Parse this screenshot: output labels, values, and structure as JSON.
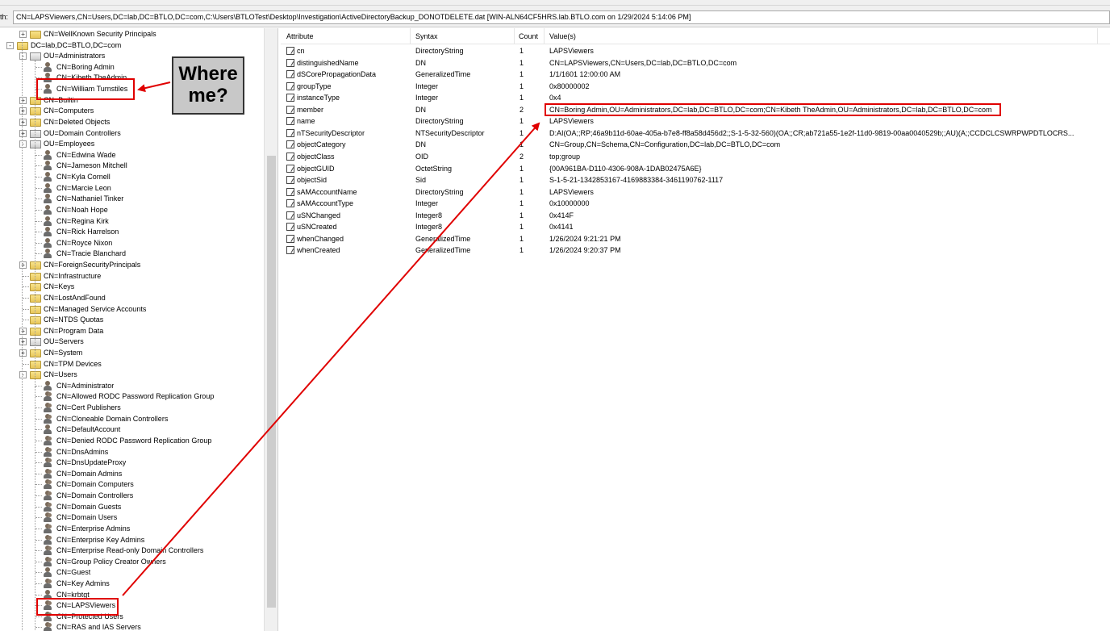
{
  "path": {
    "label": "th:",
    "value": "CN=LAPSViewers,CN=Users,DC=lab,DC=BTLO,DC=com,C:\\Users\\BTLOTest\\Desktop\\Investigation\\ActiveDirectoryBackup_DONOTDELETE.dat [WIN-ALN64CF5HRS.lab.BTLO.com on 1/29/2024 5:14:06 PM]"
  },
  "tree": [
    {
      "label": "CN=WellKnown Security Principals",
      "icon": "folder-icon",
      "expander": "+"
    },
    {
      "label": "DC=lab,DC=BTLO,DC=com",
      "icon": "domain-icon",
      "expander": "-"
    },
    {
      "label": "OU=Administrators",
      "icon": "ou-icon",
      "expander": "-"
    },
    {
      "label": "CN=Boring Admin",
      "icon": "user-icon"
    },
    {
      "label": "CN=Kibeth TheAdmin",
      "icon": "user-icon"
    },
    {
      "label": "CN=William Turnstiles",
      "icon": "user-icon"
    },
    {
      "label": "CN=Builtin",
      "icon": "folder-icon",
      "expander": "+"
    },
    {
      "label": "CN=Computers",
      "icon": "folder-icon",
      "expander": "+"
    },
    {
      "label": "CN=Deleted Objects",
      "icon": "folder-icon",
      "expander": "+"
    },
    {
      "label": "OU=Domain Controllers",
      "icon": "ou-icon",
      "expander": "+"
    },
    {
      "label": "OU=Employees",
      "icon": "ou-icon",
      "expander": "-"
    },
    {
      "label": "CN=Edwina Wade",
      "icon": "user-icon"
    },
    {
      "label": "CN=Jameson Mitchell",
      "icon": "user-icon"
    },
    {
      "label": "CN=Kyla Cornell",
      "icon": "user-icon"
    },
    {
      "label": "CN=Marcie Leon",
      "icon": "user-icon"
    },
    {
      "label": "CN=Nathaniel Tinker",
      "icon": "user-icon"
    },
    {
      "label": "CN=Noah Hope",
      "icon": "user-icon"
    },
    {
      "label": "CN=Regina Kirk",
      "icon": "user-icon"
    },
    {
      "label": "CN=Rick Harrelson",
      "icon": "user-icon"
    },
    {
      "label": "CN=Royce Nixon",
      "icon": "user-icon"
    },
    {
      "label": "CN=Tracie Blanchard",
      "icon": "user-icon"
    },
    {
      "label": "CN=ForeignSecurityPrincipals",
      "icon": "folder-icon",
      "expander": "+"
    },
    {
      "label": "CN=Infrastructure",
      "icon": "folder-icon"
    },
    {
      "label": "CN=Keys",
      "icon": "folder-icon"
    },
    {
      "label": "CN=LostAndFound",
      "icon": "folder-icon"
    },
    {
      "label": "CN=Managed Service Accounts",
      "icon": "folder-icon"
    },
    {
      "label": "CN=NTDS Quotas",
      "icon": "folder-icon"
    },
    {
      "label": "CN=Program Data",
      "icon": "folder-icon",
      "expander": "+"
    },
    {
      "label": "OU=Servers",
      "icon": "ou-icon",
      "expander": "+"
    },
    {
      "label": "CN=System",
      "icon": "folder-icon",
      "expander": "+"
    },
    {
      "label": "CN=TPM Devices",
      "icon": "folder-icon"
    },
    {
      "label": "CN=Users",
      "icon": "folder-icon",
      "expander": "-"
    },
    {
      "label": "CN=Administrator",
      "icon": "user-icon"
    },
    {
      "label": "CN=Allowed RODC Password Replication Group",
      "icon": "group-icon"
    },
    {
      "label": "CN=Cert Publishers",
      "icon": "group-icon"
    },
    {
      "label": "CN=Cloneable Domain Controllers",
      "icon": "group-icon"
    },
    {
      "label": "CN=DefaultAccount",
      "icon": "user-icon"
    },
    {
      "label": "CN=Denied RODC Password Replication Group",
      "icon": "group-icon"
    },
    {
      "label": "CN=DnsAdmins",
      "icon": "group-icon"
    },
    {
      "label": "CN=DnsUpdateProxy",
      "icon": "group-icon"
    },
    {
      "label": "CN=Domain Admins",
      "icon": "group-icon"
    },
    {
      "label": "CN=Domain Computers",
      "icon": "group-icon"
    },
    {
      "label": "CN=Domain Controllers",
      "icon": "group-icon"
    },
    {
      "label": "CN=Domain Guests",
      "icon": "group-icon"
    },
    {
      "label": "CN=Domain Users",
      "icon": "group-icon"
    },
    {
      "label": "CN=Enterprise Admins",
      "icon": "group-icon"
    },
    {
      "label": "CN=Enterprise Key Admins",
      "icon": "group-icon"
    },
    {
      "label": "CN=Enterprise Read-only Domain Controllers",
      "icon": "group-icon"
    },
    {
      "label": "CN=Group Policy Creator Owners",
      "icon": "group-icon"
    },
    {
      "label": "CN=Guest",
      "icon": "user-icon"
    },
    {
      "label": "CN=Key Admins",
      "icon": "group-icon"
    },
    {
      "label": "CN=krbtgt",
      "icon": "user-icon"
    },
    {
      "label": "CN=LAPSViewers",
      "icon": "group-icon"
    },
    {
      "label": "CN=Protected Users",
      "icon": "group-icon"
    },
    {
      "label": "CN=RAS and IAS Servers",
      "icon": "group-icon"
    }
  ],
  "grid": {
    "headers": [
      "Attribute",
      "Syntax",
      "Count",
      "Value(s)"
    ],
    "rows": [
      {
        "attr": "cn",
        "syntax": "DirectoryString",
        "count": "1",
        "value": "LAPSViewers"
      },
      {
        "attr": "distinguishedName",
        "syntax": "DN",
        "count": "1",
        "value": "CN=LAPSViewers,CN=Users,DC=lab,DC=BTLO,DC=com"
      },
      {
        "attr": "dSCorePropagationData",
        "syntax": "GeneralizedTime",
        "count": "1",
        "value": "1/1/1601 12:00:00 AM"
      },
      {
        "attr": "groupType",
        "syntax": "Integer",
        "count": "1",
        "value": "0x80000002"
      },
      {
        "attr": "instanceType",
        "syntax": "Integer",
        "count": "1",
        "value": "0x4"
      },
      {
        "attr": "member",
        "syntax": "DN",
        "count": "2",
        "value": "CN=Boring Admin,OU=Administrators,DC=lab,DC=BTLO,DC=com;CN=Kibeth TheAdmin,OU=Administrators,DC=lab,DC=BTLO,DC=com"
      },
      {
        "attr": "name",
        "syntax": "DirectoryString",
        "count": "1",
        "value": "LAPSViewers"
      },
      {
        "attr": "nTSecurityDescriptor",
        "syntax": "NTSecurityDescriptor",
        "count": "1",
        "value": "D:AI(OA;;RP;46a9b11d-60ae-405a-b7e8-ff8a58d456d2;;S-1-5-32-560)(OA;;CR;ab721a55-1e2f-11d0-9819-00aa0040529b;;AU)(A;;CCDCLCSWRPWPDTLOCRS..."
      },
      {
        "attr": "objectCategory",
        "syntax": "DN",
        "count": "1",
        "value": "CN=Group,CN=Schema,CN=Configuration,DC=lab,DC=BTLO,DC=com"
      },
      {
        "attr": "objectClass",
        "syntax": "OID",
        "count": "2",
        "value": "top;group"
      },
      {
        "attr": "objectGUID",
        "syntax": "OctetString",
        "count": "1",
        "value": "{00A961BA-D110-4306-908A-1DAB02475A6E}"
      },
      {
        "attr": "objectSid",
        "syntax": "Sid",
        "count": "1",
        "value": "S-1-5-21-1342853167-4169883384-3461190762-1117"
      },
      {
        "attr": "sAMAccountName",
        "syntax": "DirectoryString",
        "count": "1",
        "value": "LAPSViewers"
      },
      {
        "attr": "sAMAccountType",
        "syntax": "Integer",
        "count": "1",
        "value": "0x10000000"
      },
      {
        "attr": "uSNChanged",
        "syntax": "Integer8",
        "count": "1",
        "value": "0x414F"
      },
      {
        "attr": "uSNCreated",
        "syntax": "Integer8",
        "count": "1",
        "value": "0x4141"
      },
      {
        "attr": "whenChanged",
        "syntax": "GeneralizedTime",
        "count": "1",
        "value": "1/26/2024 9:21:21 PM"
      },
      {
        "attr": "whenCreated",
        "syntax": "GeneralizedTime",
        "count": "1",
        "value": "1/26/2024 9:20:37 PM"
      }
    ]
  },
  "annotation": {
    "callout_line1": "Where",
    "callout_line2": "me?",
    "color": "#e00000"
  }
}
